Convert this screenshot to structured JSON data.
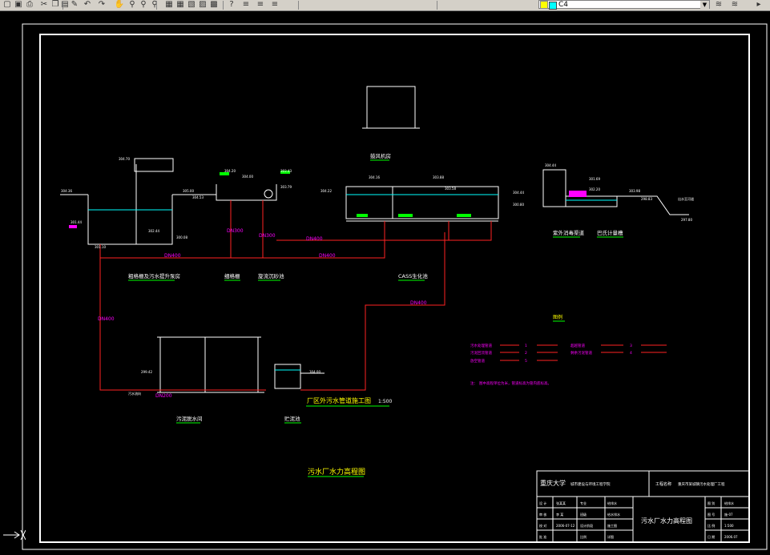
{
  "toolbar": {
    "layer_name": "C4",
    "icons": [
      "open-icon",
      "save-icon",
      "print-icon",
      "cut-icon",
      "copy-icon",
      "paste-icon",
      "match-icon",
      "undo-icon",
      "redo-icon",
      "pan-icon",
      "zoom-realtime-icon",
      "zoom-window-icon",
      "zoom-previous-icon",
      "properties-icon",
      "design-center-icon",
      "tool-palette-icon",
      "markup-icon",
      "calculator-icon",
      "help-icon",
      "layer-manager-icon",
      "layer-state-icon",
      "layer-previous-icon"
    ]
  },
  "drawing": {
    "process_labels": {
      "coarse_screen_pump": "粗格栅及污水提升泵房",
      "fine_screen": "细格栅",
      "grit_chamber": "旋流沉砂池",
      "cass_tank": "CASS生化池",
      "blower_room": "鼓风机房",
      "uv_channel": "紫外消毒渠道",
      "metering_well": "巴氏计量槽",
      "sludge_dewatering": "污泥脱水间",
      "sludge_tank": "贮泥池"
    },
    "legend": {
      "title": "图例",
      "items": [
        {
          "label": "污水处理管道",
          "num": "1"
        },
        {
          "label": "污泥回流管道",
          "num": "2"
        },
        {
          "label": "超越管道",
          "num": "3"
        },
        {
          "label": "剩余污泥管道",
          "num": "4"
        },
        {
          "label": "放空管道",
          "num": "5"
        }
      ],
      "note_label": "注：",
      "note": "图中高程单位为米，管道标高为管内底标高。"
    },
    "pipe_labels": [
      "DN400",
      "DN400",
      "DN400",
      "DN400",
      "DN400",
      "DN300",
      "DN300",
      "DN200"
    ],
    "sub_title": "厂区外污水管道施工图",
    "sub_scale": "1:500",
    "main_title": "污水厂水力高程图",
    "elevations": [
      "304.36",
      "301.44",
      "301.10",
      "304.70",
      "305.00",
      "304.53",
      "302.44",
      "300.08",
      "304.20",
      "304.00",
      "303.43",
      "303.79",
      "304.22",
      "304.16",
      "303.88",
      "303.58",
      "304.44",
      "300.80",
      "304.44",
      "301.69",
      "302.20",
      "303.98",
      "298.83",
      "297.80",
      "299.42",
      "304.00"
    ],
    "small_notes": [
      "污水流向",
      "出水至河道"
    ]
  },
  "title_block": {
    "school": "重庆大学",
    "dept": "城市建设与环境工程学院",
    "project_label": "工程名称",
    "project_name": "重庆市某城镇污水处理厂工程",
    "drawing_name": "污水厂水力高程图",
    "rows": [
      [
        "设 计",
        "张某某",
        "专业",
        "给排水"
      ],
      [
        "审 核",
        "李 某",
        "班级",
        "给水排水"
      ],
      [
        "校 对",
        "2006-07-12",
        "设计阶段",
        "施工图"
      ],
      [
        "批 准",
        "",
        "比例",
        "详图"
      ]
    ],
    "right": [
      [
        "图 别",
        "给排水"
      ],
      [
        "图 号",
        "施-07"
      ],
      [
        "比 例",
        "1:500"
      ],
      [
        "日 期",
        "2006.07"
      ]
    ]
  }
}
